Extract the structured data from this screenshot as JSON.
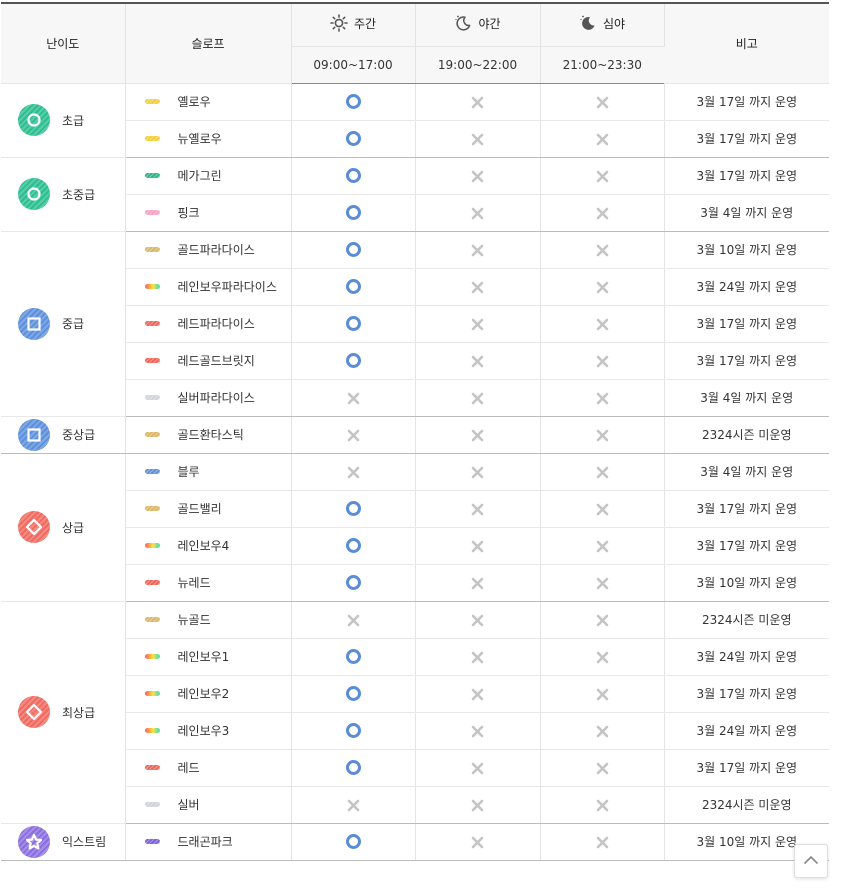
{
  "header": {
    "level": "난이도",
    "slope": "슬로프",
    "note": "비고",
    "periods": [
      {
        "label": "주간",
        "time": "09:00~17:00",
        "icon": "sun-icon"
      },
      {
        "label": "야간",
        "time": "19:00~22:00",
        "icon": "moon-icon"
      },
      {
        "label": "심야",
        "time": "21:00~23:30",
        "icon": "moon-filled-icon"
      }
    ]
  },
  "colors": {
    "open_mark": "#5a8dd6",
    "closed_mark": "#c4c4c4",
    "beginner": "#2bbf8f",
    "intermediate": "#5c8fdc",
    "advanced": "#f06a5f",
    "extreme": "#8a6ee0"
  },
  "groups": [
    {
      "level": "초급",
      "badge": "circle",
      "color": "#2bbf8f",
      "slopes": [
        {
          "name": "옐로우",
          "color": "#f2cf3a",
          "day": true,
          "night": false,
          "late": false,
          "note": "3월 17일 까지 운영"
        },
        {
          "name": "뉴옐로우",
          "color": "#f2cf3a",
          "day": true,
          "night": false,
          "late": false,
          "note": "3월 17일 까지 운영"
        }
      ]
    },
    {
      "level": "초중급",
      "badge": "circle",
      "color": "#2bbf8f",
      "slopes": [
        {
          "name": "메가그린",
          "color": "#2bb58a",
          "day": true,
          "night": false,
          "late": false,
          "note": "3월 17일 까지 운영"
        },
        {
          "name": "핑크",
          "color": "#f4a3c4",
          "day": true,
          "night": false,
          "late": false,
          "note": "3월 4일 까지 운영"
        }
      ]
    },
    {
      "level": "중급",
      "badge": "square",
      "color": "#5c8fdc",
      "slopes": [
        {
          "name": "골드파라다이스",
          "color": "#d8b766",
          "day": true,
          "night": false,
          "late": false,
          "note": "3월 10일 까지 운영"
        },
        {
          "name": "레인보우파라다이스",
          "color": "rainbow",
          "day": true,
          "night": false,
          "late": false,
          "note": "3월 24일 까지 운영"
        },
        {
          "name": "레드파라다이스",
          "color": "#f0645a",
          "day": true,
          "night": false,
          "late": false,
          "note": "3월 17일 까지 운영"
        },
        {
          "name": "레드골드브릿지",
          "color": "#f0645a",
          "day": true,
          "night": false,
          "late": false,
          "note": "3월 17일 까지 운영"
        },
        {
          "name": "실버파라다이스",
          "color": "#cfd3da",
          "day": false,
          "night": false,
          "late": false,
          "note": "3월 4일 까지 운영"
        }
      ]
    },
    {
      "level": "중상급",
      "badge": "square",
      "color": "#5c8fdc",
      "slopes": [
        {
          "name": "골드환타스틱",
          "color": "#d8b766",
          "day": false,
          "night": false,
          "late": false,
          "note": "2324시즌 미운영"
        }
      ]
    },
    {
      "level": "상급",
      "badge": "diamond",
      "color": "#f06a5f",
      "slopes": [
        {
          "name": "블루",
          "color": "#5c8fdc",
          "day": false,
          "night": false,
          "late": false,
          "note": "3월 4일 까지 운영"
        },
        {
          "name": "골드밸리",
          "color": "#d8b766",
          "day": true,
          "night": false,
          "late": false,
          "note": "3월 17일 까지 운영"
        },
        {
          "name": "레인보우4",
          "color": "rainbow",
          "day": true,
          "night": false,
          "late": false,
          "note": "3월 17일 까지 운영"
        },
        {
          "name": "뉴레드",
          "color": "#f0645a",
          "day": true,
          "night": false,
          "late": false,
          "note": "3월 10일 까지 운영"
        }
      ]
    },
    {
      "level": "최상급",
      "badge": "diamond",
      "color": "#f06a5f",
      "slopes": [
        {
          "name": "뉴골드",
          "color": "#d8b766",
          "day": false,
          "night": false,
          "late": false,
          "note": "2324시즌 미운영"
        },
        {
          "name": "레인보우1",
          "color": "rainbow",
          "day": true,
          "night": false,
          "late": false,
          "note": "3월 24일 까지 운영"
        },
        {
          "name": "레인보우2",
          "color": "rainbow",
          "day": true,
          "night": false,
          "late": false,
          "note": "3월 17일 까지 운영"
        },
        {
          "name": "레인보우3",
          "color": "rainbow",
          "day": true,
          "night": false,
          "late": false,
          "note": "3월 24일 까지 운영"
        },
        {
          "name": "레드",
          "color": "#f0645a",
          "day": true,
          "night": false,
          "late": false,
          "note": "3월 17일 까지 운영"
        },
        {
          "name": "실버",
          "color": "#cfd3da",
          "day": false,
          "night": false,
          "late": false,
          "note": "2324시즌 미운영"
        }
      ]
    },
    {
      "level": "익스트림",
      "badge": "star",
      "color": "#8a6ee0",
      "slopes": [
        {
          "name": "드래곤파크",
          "color": "#7b5fe0",
          "day": true,
          "night": false,
          "late": false,
          "note": "3월 10일 까지 운영"
        }
      ]
    }
  ],
  "scroll_top": {
    "icon": "chevron-up-icon"
  }
}
